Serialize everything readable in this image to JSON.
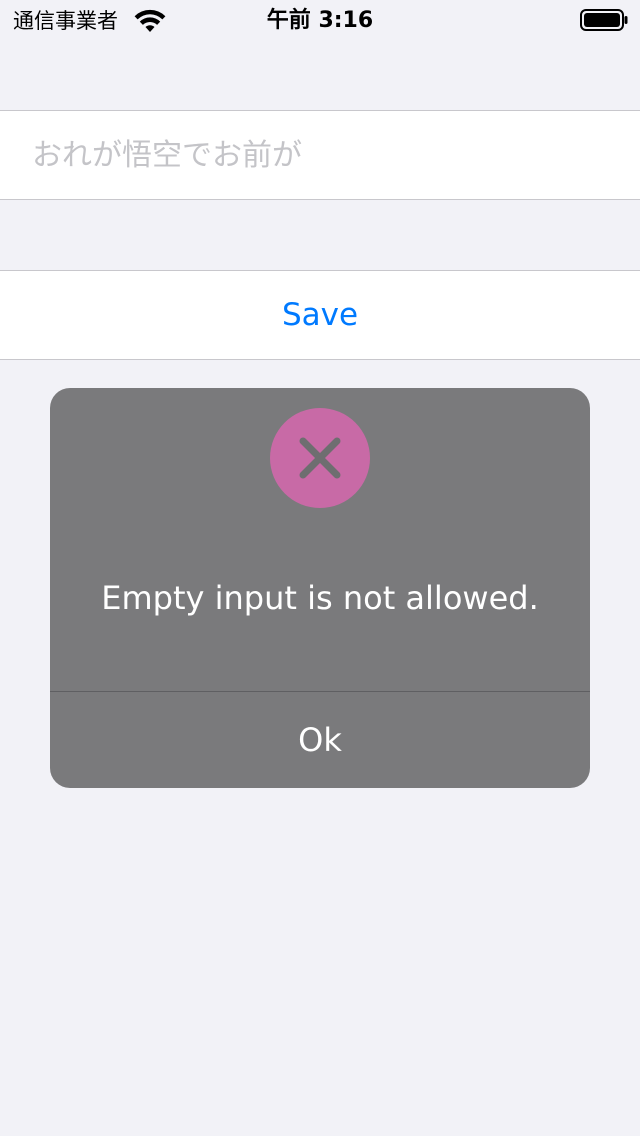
{
  "status_bar": {
    "carrier": "通信事業者",
    "time": "午前 3:16",
    "wifi_icon": "wifi-icon",
    "battery_icon": "battery-full-icon"
  },
  "text_field": {
    "value": "",
    "placeholder": "おれが悟空でお前が"
  },
  "save_button": {
    "label": "Save",
    "color": "#007aff"
  },
  "alert": {
    "icon": "close-icon",
    "icon_color": "#c86aa6",
    "message": "Empty input is not allowed.",
    "ok_label": "Ok",
    "background": "#7a7a7c"
  }
}
